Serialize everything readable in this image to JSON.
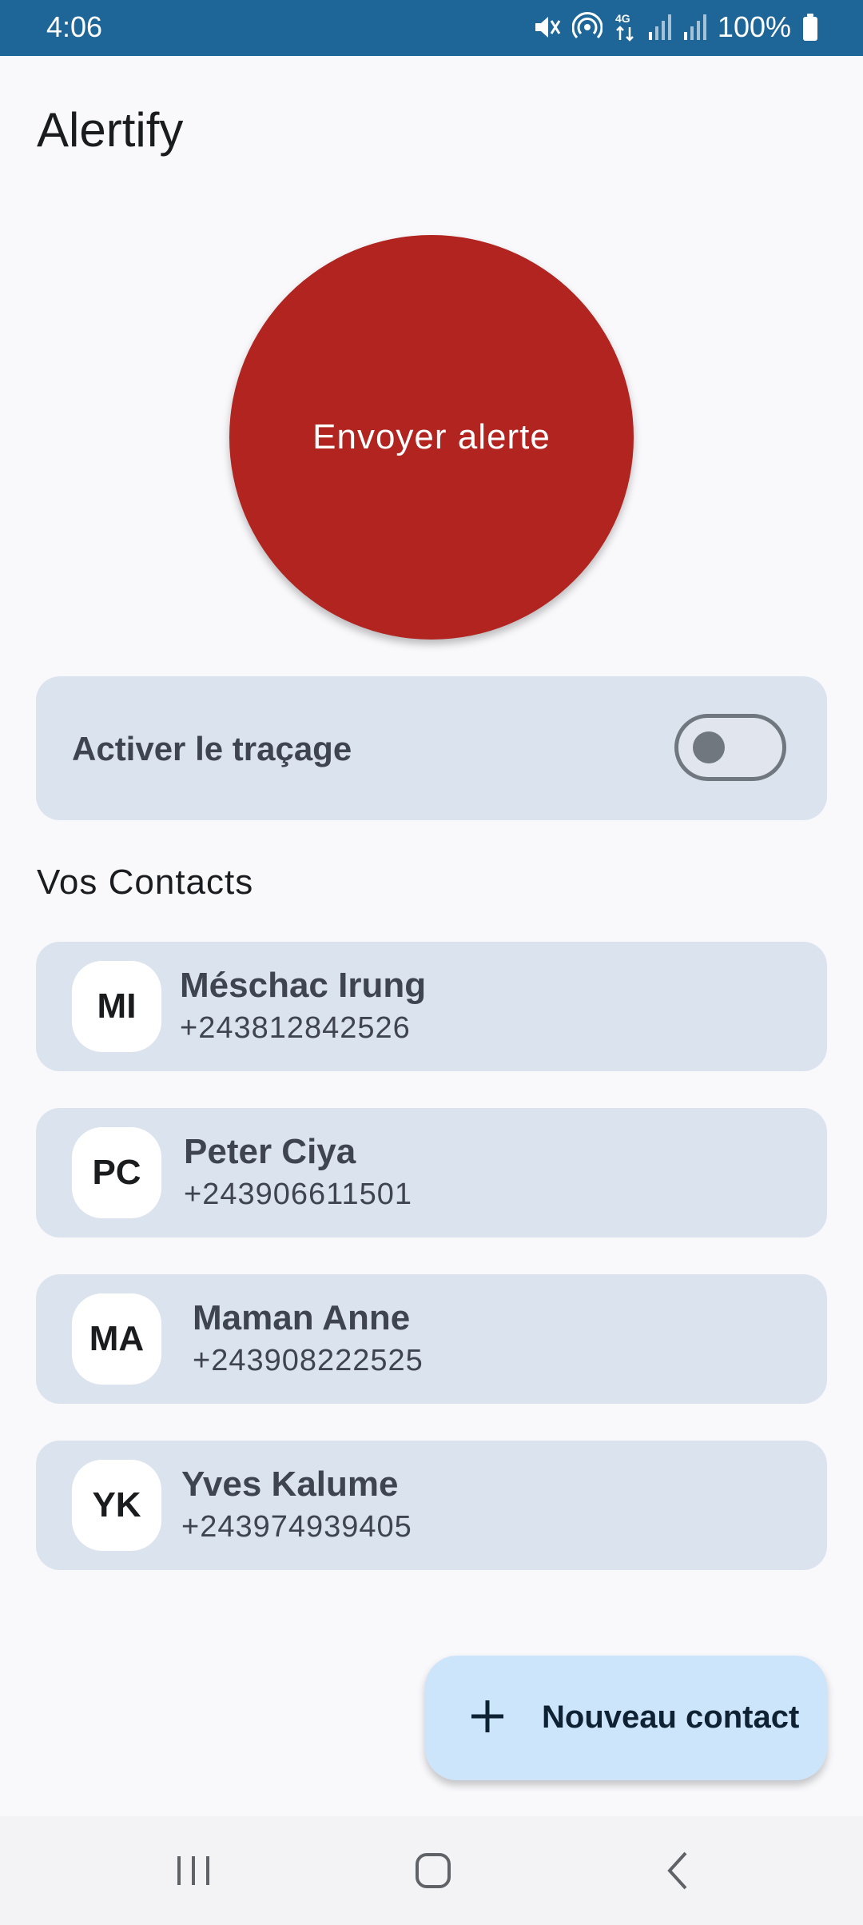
{
  "status_bar": {
    "time": "4:06",
    "battery": "100%",
    "network_type": "4G",
    "icons": [
      "mute-icon",
      "hotspot-icon",
      "network-4g-icon",
      "signal-icon",
      "signal-icon",
      "battery-icon"
    ]
  },
  "app": {
    "title": "Alertify"
  },
  "alert_button": {
    "label": "Envoyer alerte",
    "color": "#b1241f"
  },
  "tracking": {
    "label": "Activer le traçage",
    "enabled": false
  },
  "contacts": {
    "heading": "Vos Contacts",
    "items": [
      {
        "initials": "MI",
        "name": "Méschac Irung",
        "phone": "+243812842526"
      },
      {
        "initials": "PC",
        "name": "Peter Ciya",
        "phone": "+243906611501"
      },
      {
        "initials": "MA",
        "name": "Maman Anne",
        "phone": "+243908222525"
      },
      {
        "initials": "YK",
        "name": "Yves Kalume",
        "phone": "+243974939405"
      }
    ]
  },
  "fab": {
    "label": "Nouveau contact",
    "icon": "plus-icon"
  },
  "nav_bar": {
    "icons": [
      "recent-apps-icon",
      "home-icon",
      "back-icon"
    ]
  },
  "colors": {
    "status_bar": "#1f6698",
    "card": "#dbe3ee",
    "fab": "#cde5fb"
  }
}
